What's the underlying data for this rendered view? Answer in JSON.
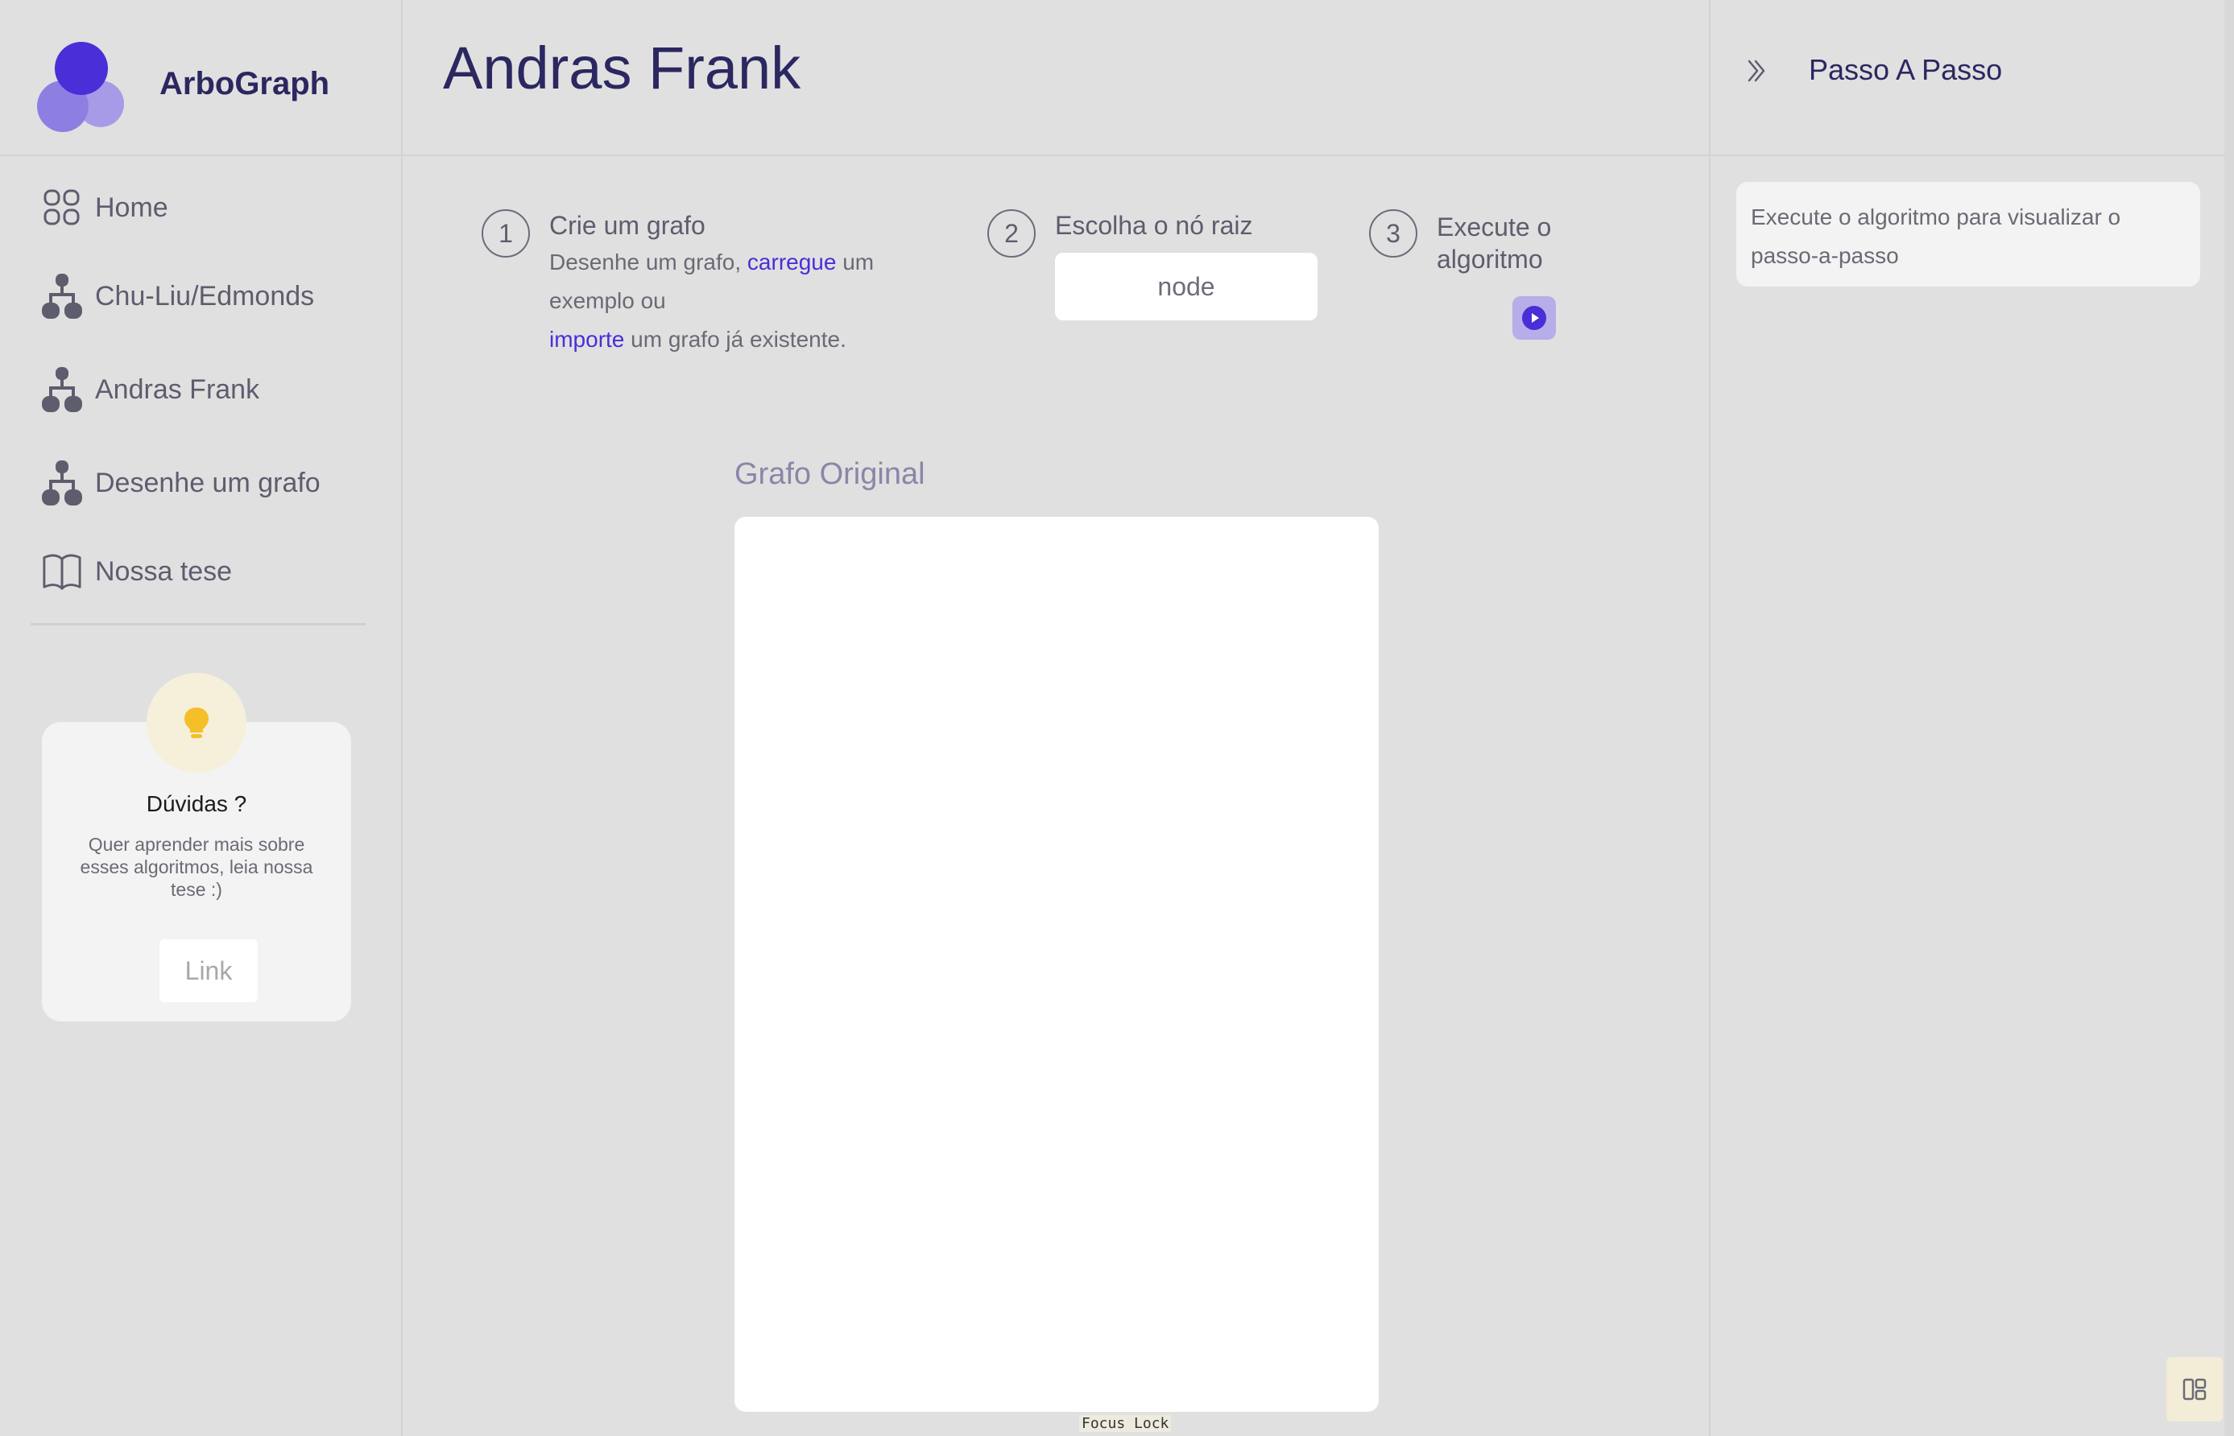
{
  "app": {
    "name": "ArboGraph"
  },
  "sidebar": {
    "items": [
      {
        "label": "Home",
        "icon": "grid-icon"
      },
      {
        "label": "Chu-Liu/Edmonds",
        "icon": "hierarchy-icon"
      },
      {
        "label": "Andras Frank",
        "icon": "hierarchy-icon"
      },
      {
        "label": "Desenhe um grafo",
        "icon": "hierarchy-icon"
      },
      {
        "label": "Nossa tese",
        "icon": "book-icon"
      }
    ],
    "help": {
      "title": "Dúvidas ?",
      "text": "Quer aprender mais sobre esses algoritmos, leia nossa tese :)",
      "button": "Link",
      "icon": "lightbulb-icon"
    }
  },
  "header": {
    "title": "Andras Frank"
  },
  "steps": [
    {
      "number": "1",
      "title": "Crie um grafo",
      "text_before": "Desenhe um grafo, ",
      "link1": "carregue",
      "text_middle": " um exemplo ou",
      "link2": "importe",
      "text_after": " um grafo já existente."
    },
    {
      "number": "2",
      "title": "Escolha o nó raiz",
      "input_placeholder": "node"
    },
    {
      "number": "3",
      "title_line1": "Execute o",
      "title_line2": "algoritmo",
      "button_icon": "play-icon"
    }
  ],
  "graph": {
    "label": "Grafo Original"
  },
  "right_panel": {
    "title": "Passo A Passo",
    "message": "Execute o algoritmo para visualizar o passo-a-passo",
    "collapse_icon": "double-chevron-right-icon"
  },
  "overlay": {
    "focus_lock": "Focus Lock"
  },
  "colors": {
    "accent": "#4a2ed8",
    "title": "#2b2760",
    "background": "#e0e0e0"
  }
}
